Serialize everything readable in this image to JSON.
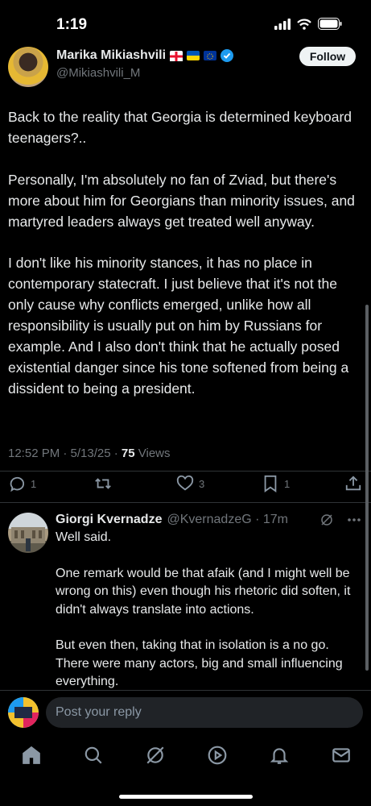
{
  "status_bar": {
    "time": "1:19"
  },
  "author": {
    "name": "Marika Mikiashvili",
    "handle": "@Mikiashvili_M",
    "follow_label": "Follow"
  },
  "tweet": {
    "paragraphs": [
      "Back to the reality that Georgia is determined keyboard teenagers?..",
      "Personally, I'm absolutely no fan of Zviad, but there's more about him for Georgians than minority issues, and martyred leaders always get treated well anyway.",
      "I don't like his minority stances, it has no place in contemporary statecraft. I just believe that it's not the only cause why conflicts emerged, unlike how all responsibility is usually put on him by Russians for example. And I also don't think that he actually posed existential danger since his tone softened from being a dissident to being a president."
    ],
    "timestamp": "12:52 PM · 5/13/25 · ",
    "views_count": "75",
    "views_label": " Views"
  },
  "actions": {
    "replies": "1",
    "likes": "3",
    "bookmarks": "1"
  },
  "reply": {
    "name": "Giorgi Kvernadze",
    "handle": "@KvernadzeG · 17m",
    "paragraphs": [
      "Well said.",
      "One remark would be that afaik (and I might well be wrong on this) even though his rhetoric did soften, it didn't always translate into actions.",
      "But even then, taking that in isolation is a no go. There were many actors, big and small influencing everything."
    ]
  },
  "compose": {
    "placeholder": "Post your reply"
  },
  "colors": {
    "accent": "#1d9bf0",
    "background": "#000000",
    "muted": "#71767b",
    "text": "#e7e9ea"
  },
  "icons": [
    "reply-icon",
    "retweet-icon",
    "like-icon",
    "bookmark-icon",
    "share-icon",
    "grok-icon",
    "more-icon",
    "home-icon",
    "search-icon",
    "communities-icon",
    "play-icon",
    "bell-icon",
    "mail-icon"
  ]
}
